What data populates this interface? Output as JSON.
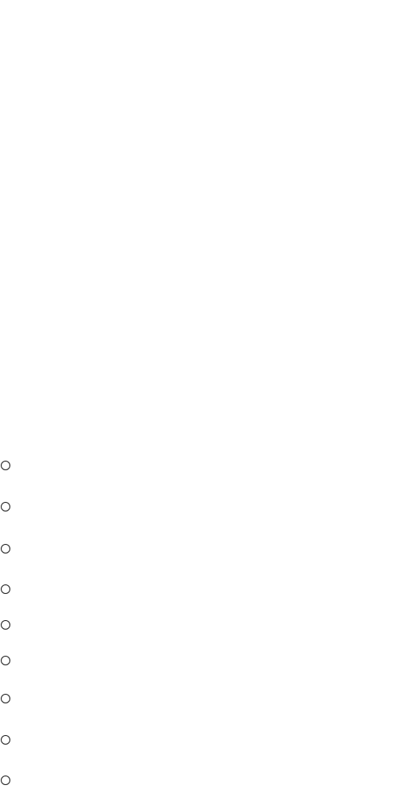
{
  "radio_group": {
    "options": [
      {
        "checked": false
      },
      {
        "checked": false
      },
      {
        "checked": false
      },
      {
        "checked": false
      },
      {
        "checked": false
      },
      {
        "checked": false
      },
      {
        "checked": false
      },
      {
        "checked": false
      },
      {
        "checked": false
      }
    ]
  }
}
